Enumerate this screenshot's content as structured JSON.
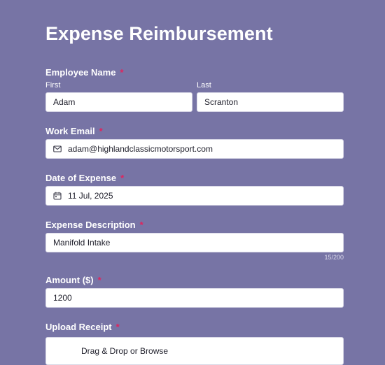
{
  "form": {
    "title": "Expense Reimbursement",
    "required_marker": "*",
    "employee_name": {
      "label": "Employee Name",
      "first": {
        "sublabel": "First",
        "value": "Adam"
      },
      "last": {
        "sublabel": "Last",
        "value": "Scranton"
      }
    },
    "work_email": {
      "label": "Work Email",
      "value": "adam@highlandclassicmotorsport.com",
      "icon": "mail-icon"
    },
    "date_of_expense": {
      "label": "Date of Expense",
      "value": "11 Jul, 2025",
      "icon": "calendar-icon"
    },
    "expense_description": {
      "label": "Expense Description",
      "value": "Manifold Intake",
      "counter": "15/200"
    },
    "amount": {
      "label": "Amount ($)",
      "value": "1200"
    },
    "upload_receipt": {
      "label": "Upload Receipt",
      "text": "Drag & Drop or Browse"
    }
  },
  "colors": {
    "background": "#7774a5",
    "required": "#e0245e",
    "input_bg": "#ffffff",
    "input_text": "#1e1e2a"
  }
}
